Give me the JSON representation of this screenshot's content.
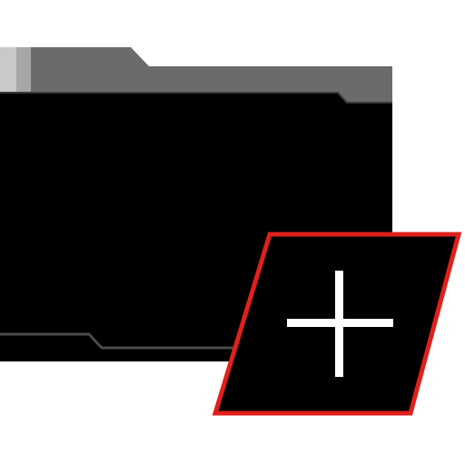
{
  "icon": {
    "name": "new-folder-icon",
    "parts": {
      "folder": "folder-icon",
      "add_badge": "add-badge",
      "plus": "plus-icon"
    }
  },
  "colors": {
    "background": "#ffffff",
    "folder_tab": "#6b6b6b",
    "folder_tab_highlight": "#a6a6a6",
    "folder_tab_light": "#c9c9c9",
    "folder_body": "#000000",
    "folder_edge": "#3a3a3a",
    "folder_bottom_line": "#4a4a4a",
    "badge_fill": "#000000",
    "badge_border": "#e0201c",
    "plus": "#ffffff"
  }
}
